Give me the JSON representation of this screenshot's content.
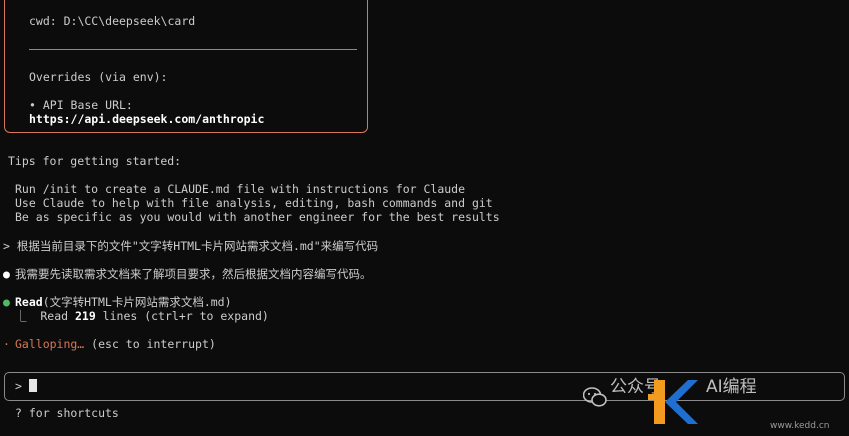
{
  "welcome_box": {
    "cwd": "cwd: D:\\CC\\deepseek\\card",
    "overrides_title": "Overrides (via env):",
    "api_base_label": "• API Base URL:",
    "api_base_url": "https://api.deepseek.com/anthropic"
  },
  "tips": {
    "title": "Tips for getting started:",
    "items": [
      "Run /init to create a CLAUDE.md file with instructions for Claude",
      "Use Claude to help with file analysis, editing, bash commands and git",
      "Be as specific as you would with another engineer for the best results"
    ]
  },
  "conversation": {
    "user_prompt": "> 根据当前目录下的文件\"文字转HTML卡片网站需求文档.md\"来编写代码",
    "assistant_message": "我需要先读取需求文档来了解项目要求，然后根据文档内容编写代码。",
    "tool_name": "Read",
    "tool_args": "(文字转HTML卡片网站需求文档.md)",
    "tool_result_prefix": "⎿  Read ",
    "tool_result_count": "219",
    "tool_result_suffix": " lines (ctrl+r to expand)",
    "status_word": "Galloping…",
    "status_hint": " (esc to interrupt)"
  },
  "input": {
    "prompt": ">",
    "value": ""
  },
  "footer": {
    "shortcuts_hint": "? for shortcuts"
  },
  "watermark": {
    "text_left": "公众号",
    "text_right": "AI编程",
    "url": "www.kedd.cn"
  },
  "colors": {
    "background": "#0c0c0c",
    "accent": "#d77757",
    "success": "#4eba65"
  }
}
